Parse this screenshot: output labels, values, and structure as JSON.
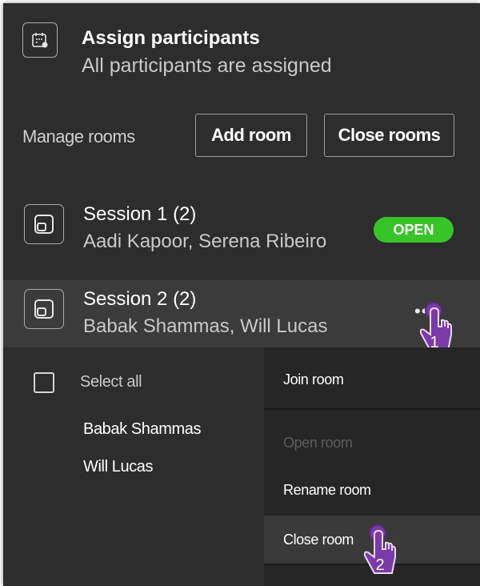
{
  "header": {
    "title": "Assign participants",
    "subtitle": "All participants are assigned"
  },
  "manage": {
    "label": "Manage rooms",
    "add_room": "Add room",
    "close_rooms": "Close rooms"
  },
  "sessions": [
    {
      "title": "Session 1 (2)",
      "members": "Aadi Kapoor, Serena Ribeiro",
      "status": "OPEN"
    },
    {
      "title": "Session 2 (2)",
      "members": "Babak Shammas, Will Lucas"
    }
  ],
  "participants": {
    "select_all": "Select all",
    "names": [
      "Babak Shammas",
      "Will Lucas"
    ]
  },
  "menu": {
    "items": [
      {
        "label": "Join room",
        "enabled": true
      },
      {
        "label": "Open room",
        "enabled": false
      },
      {
        "label": "Rename room",
        "enabled": true
      },
      {
        "label": "Close room",
        "enabled": true
      }
    ]
  },
  "annotations": {
    "step1": "1",
    "step2": "2"
  },
  "colors": {
    "panel_bg": "#2d2d2d",
    "open_badge": "#37c429",
    "pointer_accent": "#7a3aa8"
  }
}
